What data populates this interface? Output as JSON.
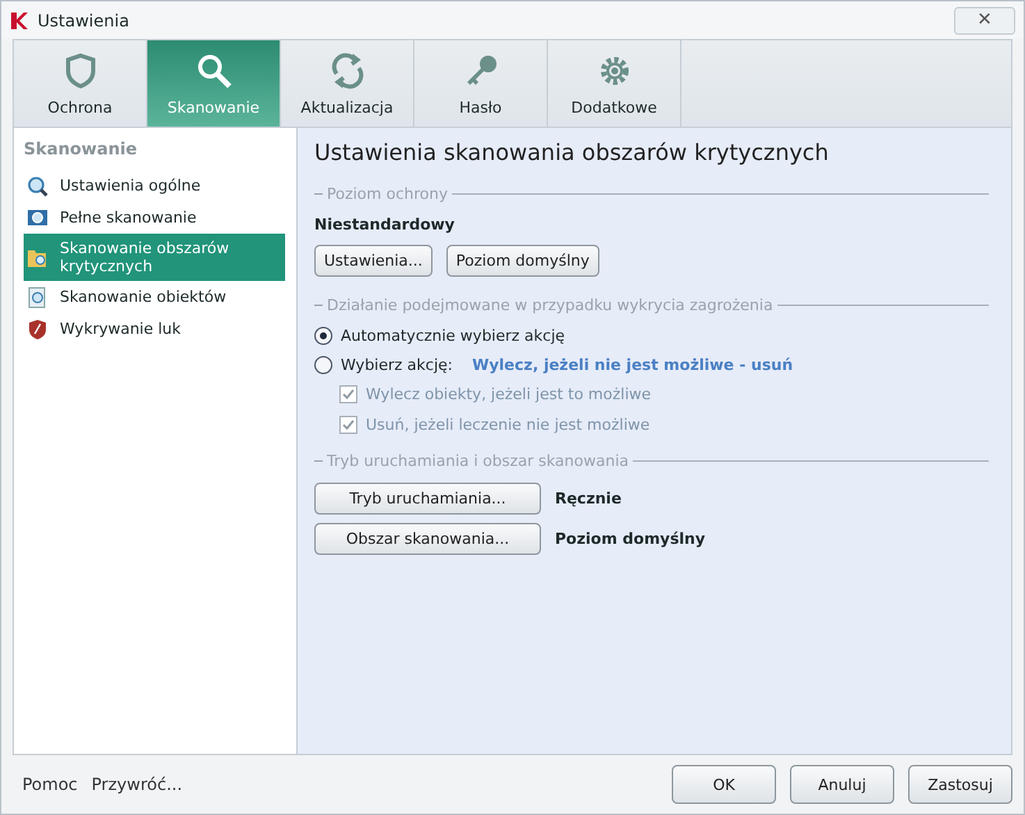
{
  "window": {
    "title": "Ustawienia",
    "close": "✕"
  },
  "tabs": [
    {
      "label": "Ochrona",
      "selected": false
    },
    {
      "label": "Skanowanie",
      "selected": true
    },
    {
      "label": "Aktualizacja",
      "selected": false
    },
    {
      "label": "Hasło",
      "selected": false
    },
    {
      "label": "Dodatkowe",
      "selected": false
    }
  ],
  "sidebar": {
    "heading": "Skanowanie",
    "items": [
      {
        "label": "Ustawienia ogólne",
        "selected": false
      },
      {
        "label": "Pełne skanowanie",
        "selected": false
      },
      {
        "label": "Skanowanie obszarów krytycznych",
        "selected": true
      },
      {
        "label": "Skanowanie obiektów",
        "selected": false
      },
      {
        "label": "Wykrywanie luk",
        "selected": false
      }
    ]
  },
  "content": {
    "title": "Ustawienia skanowania obszarów krytycznych",
    "protection": {
      "legend": "Poziom ochrony",
      "level": "Niestandardowy",
      "buttons": [
        "Ustawienia...",
        "Poziom domyślny"
      ]
    },
    "action": {
      "legend": "Działanie podejmowane w przypadku wykrycia zagrożenia",
      "radios": [
        {
          "label": "Automatycznie wybierz akcję",
          "selected": true
        },
        {
          "label": "Wybierz akcję:",
          "value": "Wylecz, jeżeli nie jest możliwe - usuń",
          "selected": false
        }
      ],
      "checkboxes": [
        {
          "label": "Wylecz obiekty, jeżeli jest to możliwe",
          "checked": true,
          "disabled": true
        },
        {
          "label": "Usuń, jeżeli leczenie nie jest możliwe",
          "checked": true,
          "disabled": true
        }
      ]
    },
    "run": {
      "legend": "Tryb uruchamiania i obszar skanowania",
      "rows": [
        {
          "button": "Tryb uruchamiania...",
          "value": "Ręcznie"
        },
        {
          "button": "Obszar skanowania...",
          "value": "Poziom domyślny"
        }
      ]
    }
  },
  "footer": {
    "links": [
      "Pomoc",
      "Przywróć..."
    ],
    "buttons": [
      "OK",
      "Anuluj",
      "Zastosuj"
    ]
  }
}
